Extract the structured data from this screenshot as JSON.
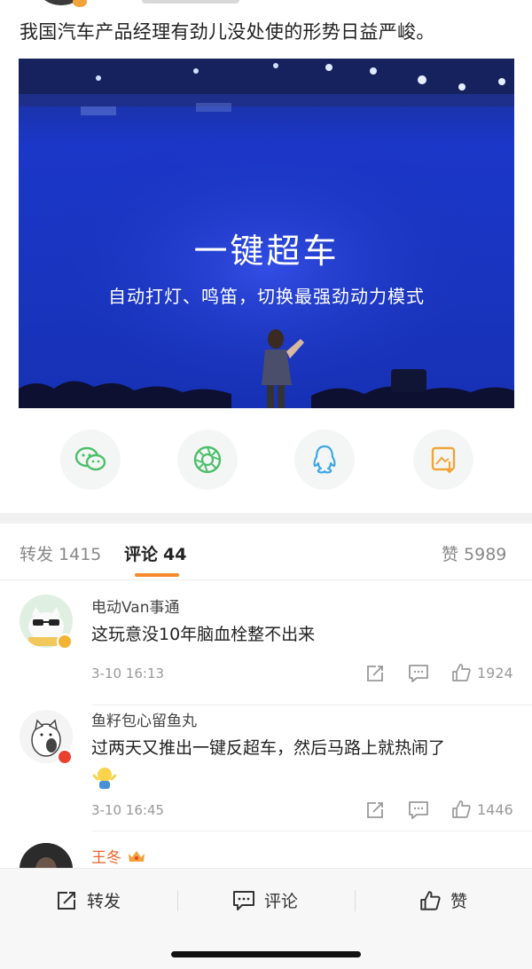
{
  "post": {
    "text": "我国汽车产品经理有劲儿没处使的形势日益严峻。",
    "media": {
      "headline": "一键超车",
      "subline": "自动打灯、鸣笛，切换最强劲动力模式"
    }
  },
  "share": {
    "items": [
      {
        "icon": "wechat-icon",
        "color": "#4cbf6a"
      },
      {
        "icon": "moments-icon",
        "color": "#4cbf6a"
      },
      {
        "icon": "qq-icon",
        "color": "#3aa6e8"
      },
      {
        "icon": "save-image-icon",
        "color": "#f0a43a"
      }
    ]
  },
  "tabs": {
    "repost": {
      "label": "转发",
      "count": "1415"
    },
    "comment": {
      "label": "评论",
      "count": "44"
    },
    "like": {
      "label": "赞",
      "count": "5989"
    },
    "accent": "#f48a2b"
  },
  "comments": [
    {
      "name": "电动Van事通",
      "text": "这玩意没10年脑血栓整不出来",
      "time": "3-10 16:13",
      "likes": "1924",
      "badge_color": "#f2b233"
    },
    {
      "name": "鱼籽包心留鱼丸",
      "text": "过两天又推出一键反超车，然后马路上就热闹了",
      "emoji": "shrug-emoji",
      "time": "3-10 16:45",
      "likes": "1446",
      "badge_color": "#e8412e"
    },
    {
      "name": "王冬",
      "name_color": "#e8652a",
      "crown": "crown-icon"
    }
  ],
  "bottom_bar": {
    "repost": "转发",
    "comment": "评论",
    "like": "赞"
  }
}
